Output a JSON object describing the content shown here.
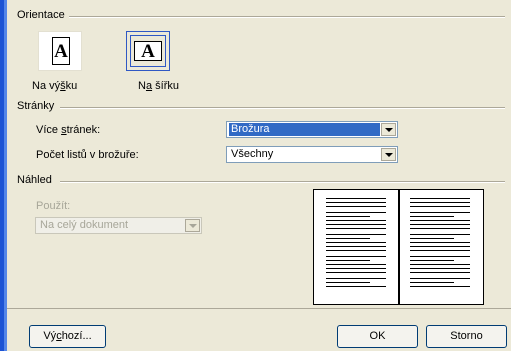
{
  "orientation": {
    "group_label": "Orientace",
    "portrait": {
      "label_pre": "Na vý",
      "label_mnemonic": "š",
      "label_post": "ku",
      "icon_glyph": "A"
    },
    "landscape": {
      "label_pre": "N",
      "label_mnemonic": "a",
      "label_post": " šířku",
      "icon_glyph": "A"
    },
    "selected": "landscape"
  },
  "pages": {
    "group_label": "Stránky",
    "multiple_pages": {
      "label_pre": "Více ",
      "label_mnemonic": "s",
      "label_post": "tránek:",
      "value": "Brožura"
    },
    "sheets_in_booklet": {
      "label": "Počet listů v brožuře:",
      "value": "Všechny"
    }
  },
  "preview": {
    "group_label": "Náhled",
    "apply_label": "Použít:",
    "apply_value": "Na celý dokument",
    "apply_enabled": false
  },
  "buttons": {
    "default": {
      "label_pre": "Vý",
      "label_mnemonic": "c",
      "label_post": "hozí..."
    },
    "ok": "OK",
    "cancel": "Storno"
  },
  "colors": {
    "dialog_bg": "#ece9d8",
    "selection_blue": "#316ac5",
    "window_edge_blue": "#1c53d4"
  }
}
